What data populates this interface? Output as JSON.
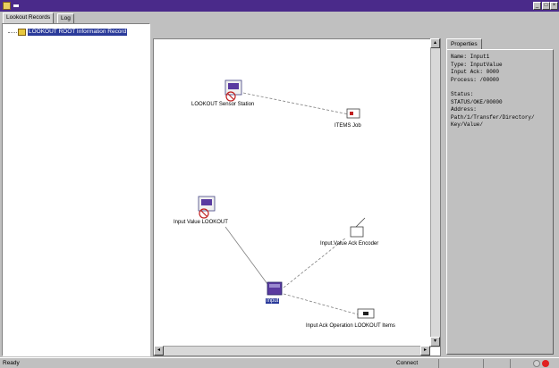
{
  "window": {
    "title": ""
  },
  "tabs": [
    {
      "label": "Lookout Records"
    },
    {
      "label": "Log"
    }
  ],
  "tree": {
    "root_label": "LOOKOUT ROOT Information Record"
  },
  "diagram": {
    "nodes": [
      {
        "label": "LOOKOUT Sensor Station"
      },
      {
        "label": "ITEMS Job"
      },
      {
        "label": "Input Value LOOKOUT"
      },
      {
        "label": "Input.Value Ack Encoder"
      },
      {
        "label": "Input"
      },
      {
        "label": "Input Ack Operation LOOKOUT Items"
      }
    ]
  },
  "properties": {
    "tab_label": "Properties",
    "lines_a": [
      "Name:     Input1",
      "Type:     InputValue",
      "Input Ack: 0000",
      "Process: /00000"
    ],
    "lines_b": [
      "Status:",
      "STATUS/OKE/00000",
      "Address:",
      "Path/1/Transfer/Directory/",
      "Key/Value/"
    ]
  },
  "status": {
    "left": "Ready",
    "right": "Connect"
  },
  "colors": {
    "titlebar": "#4a2a8a",
    "selection": "#2a3a9a",
    "node_icon": "#5a3aa0"
  }
}
